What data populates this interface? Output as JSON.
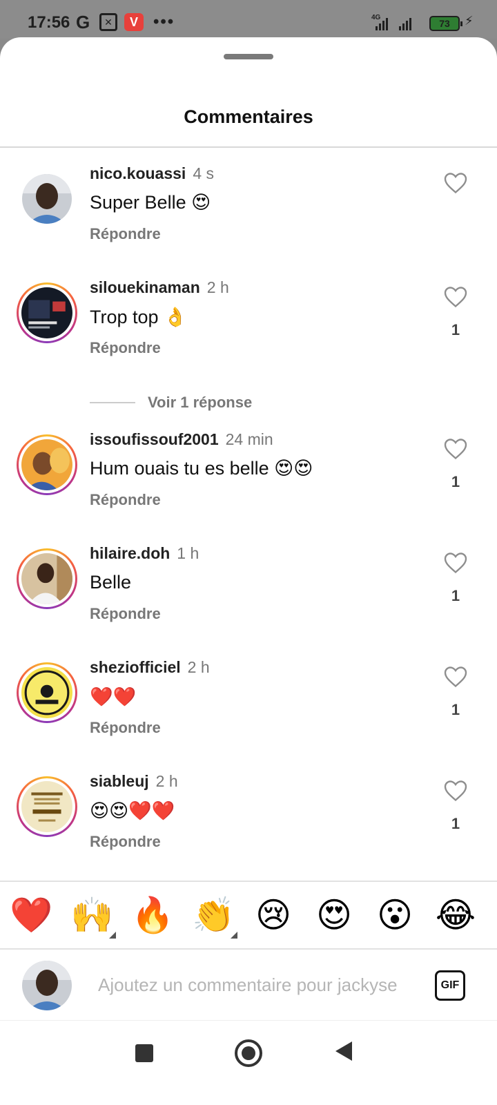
{
  "status_bar": {
    "time": "17:56",
    "google_icon": "G",
    "app_icon_v": "V",
    "more": "•••",
    "network": "4G",
    "battery": "73",
    "charging_icon": "⚡"
  },
  "sheet": {
    "title": "Commentaires"
  },
  "comments": [
    {
      "username": "nico.kouassi",
      "time": "4 s",
      "text": "Super Belle 😍",
      "reply": "Répondre",
      "likes": ""
    },
    {
      "username": "silouekinaman",
      "time": "2 h",
      "text": "Trop top 👌",
      "reply": "Répondre",
      "likes": "1"
    },
    {
      "username": "issoufissouf2001",
      "time": "24 min",
      "text": "Hum ouais tu es belle 😍😍",
      "reply": "Répondre",
      "likes": "1"
    },
    {
      "username": "hilaire.doh",
      "time": "1 h",
      "text": "Belle",
      "reply": "Répondre",
      "likes": "1"
    },
    {
      "username": "sheziofficiel",
      "time": "2 h",
      "text": "❤️❤️",
      "reply": "Répondre",
      "likes": "1"
    },
    {
      "username": "siableuj",
      "time": "2 h",
      "text": "😍😍❤️❤️",
      "reply": "Répondre",
      "likes": "1"
    }
  ],
  "view_replies": "Voir 1 réponse",
  "reactions": [
    "❤️",
    "🙌",
    "🔥",
    "👏",
    "😢",
    "😍",
    "😮",
    "😂"
  ],
  "compose": {
    "placeholder": "Ajoutez un commentaire pour jackyse",
    "gif_label": "GIF"
  },
  "colors": {
    "ring_gradient": [
      "#f9c02d",
      "#f56040",
      "#c13584"
    ],
    "heart_outline": "#8e8e8e"
  }
}
